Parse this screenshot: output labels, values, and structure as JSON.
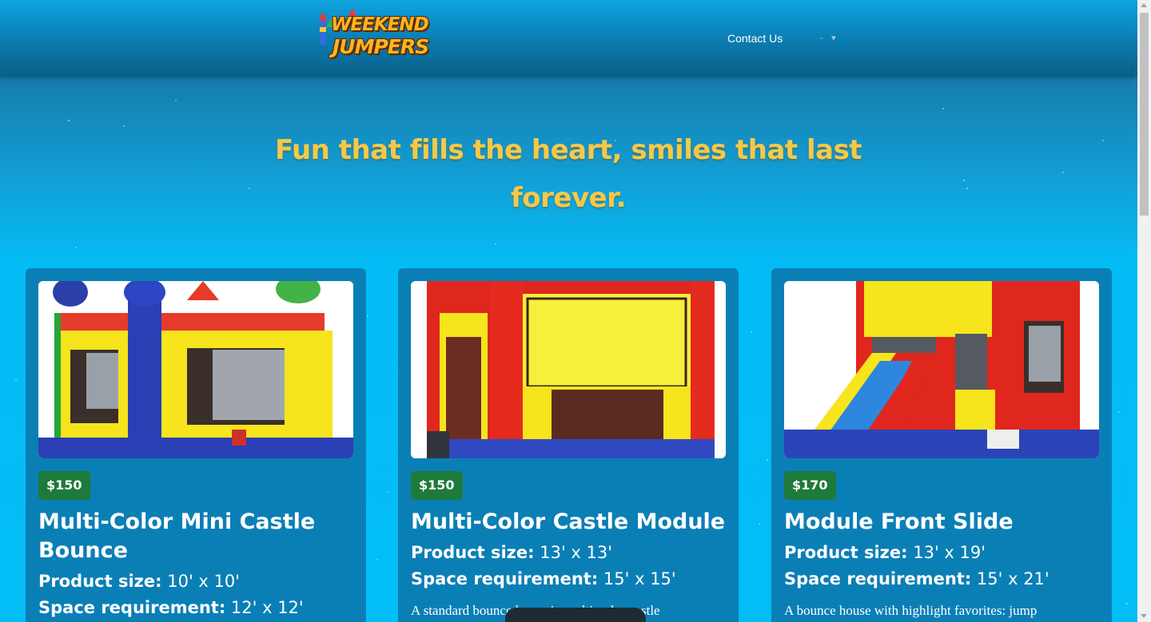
{
  "header": {
    "logo_alt": "Weekend Jumpers",
    "logo_line1": "WEEKEND",
    "logo_line2": "JUMPERS",
    "nav_contact": "Contact Us",
    "nav_dropdown": "-"
  },
  "hero": {
    "title": "Fun that fills the heart, smiles that last forever."
  },
  "colors": {
    "hero_title": "#f5c84a",
    "card_bg": "#0a7fb6",
    "price_badge": "#1e7a3a",
    "logo_orange": "#ffb41f"
  },
  "products": [
    {
      "price": "$150",
      "title": "Multi-Color Mini Castle Bounce",
      "size_label": "Product size:",
      "size_value": "10' x 10'",
      "space_label": "Space requirement:",
      "space_value": "12' x 12'",
      "description": ""
    },
    {
      "price": "$150",
      "title": "Multi-Color Castle Module",
      "size_label": "Product size:",
      "size_value": "13' x 13'",
      "space_label": "Space requirement:",
      "space_value": "15' x 15'",
      "description": "A standard bounce house in multi-color castle"
    },
    {
      "price": "$170",
      "title": "Module Front Slide",
      "size_label": "Product size:",
      "size_value": "13' x 19'",
      "space_label": "Space requirement:",
      "space_value": "15' x 21'",
      "description": "A bounce house with highlight favorites: jump"
    }
  ]
}
